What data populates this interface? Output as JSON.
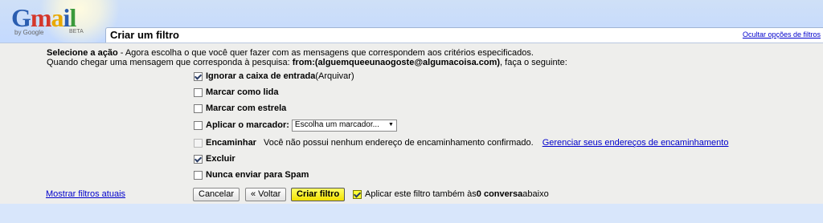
{
  "brand": {
    "logo_letters": [
      "G",
      "m",
      "a",
      "i",
      "l"
    ],
    "by_google": "by Google",
    "beta": "BETA"
  },
  "header": {
    "title": "Criar um filtro",
    "hide_options_link": "Ocultar opções de filtros"
  },
  "intro": {
    "line1_bold": "Selecione a ação",
    "line1_rest": " - Agora escolha o que você quer fazer com as mensagens que correspondem aos critérios especificados.",
    "line2_prefix": "Quando chegar uma mensagem que corresponda à pesquisa: ",
    "line2_query": "from:(alguemqueeunaogoste@algumacoisa.com)",
    "line2_suffix": ", faça o seguinte:"
  },
  "actions": {
    "skip_inbox": {
      "label": "Ignorar a caixa de entrada",
      "hint": " (Arquivar)",
      "checked": true
    },
    "mark_read": {
      "label": "Marcar como lida",
      "checked": false
    },
    "star": {
      "label": "Marcar com estrela",
      "checked": false
    },
    "apply_label": {
      "label": "Aplicar o marcador:",
      "checked": false,
      "select_value": "Escolha um marcador..."
    },
    "forward": {
      "label": "Encaminhar",
      "note": "Você não possui nenhum endereço de encaminhamento confirmado.",
      "manage_link": "Gerenciar seus endereços de encaminhamento",
      "checked": false,
      "disabled": true
    },
    "delete": {
      "label": "Excluir",
      "checked": true
    },
    "never_spam": {
      "label": "Nunca enviar para Spam",
      "checked": false
    }
  },
  "footer": {
    "show_filters_link": "Mostrar filtros atuais",
    "cancel": "Cancelar",
    "back": "« Voltar",
    "create": "Criar filtro",
    "apply_prefix": "Aplicar este filtro também às ",
    "apply_count": "0 conversa",
    "apply_suffix": " abaixo",
    "apply_checked": true
  },
  "colors": {
    "background": "#c3d9ff",
    "panel": "#eeeeec",
    "link": "#0000cc",
    "primary_button": "#ffff33"
  }
}
